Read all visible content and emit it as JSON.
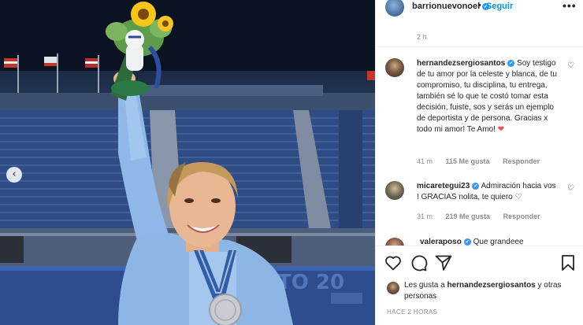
{
  "post": {
    "owner": "barrionuevonoel",
    "follow_label": "Seguir",
    "more_label": "•••",
    "time_ago": "2 h",
    "carousel_prev_icon": "chevron-left-icon",
    "carousel_prev_glyph": "‹"
  },
  "comments": [
    {
      "user": "hernandezsergiosantos",
      "text": "Soy testigo de tu amor por la celeste y blanca, de tu compromiso, tu disciplina, tu entrega, también sé lo que te costó tomar esta decisión, fuiste, sos y serás un ejemplo de deportista y de persona. Gracias x todo mi amor! Te Amo!",
      "emoji": "❤",
      "time": "41 m",
      "likes": "115 Me gusta",
      "reply": "Responder"
    },
    {
      "user": "micaretegui23",
      "text": "Admiración hacia vos ! GRACIAS nolita, te quiero",
      "emoji": "♡",
      "time": "31 m",
      "likes": "219 Me gusta",
      "reply": "Responder"
    },
    {
      "user": "valeraposo",
      "text": "Que grandeee"
    }
  ],
  "likes_summary": {
    "prefix": "Les gusta a ",
    "user": "hernandezsergiosantos",
    "suffix": " y otras personas"
  },
  "timestamp_label": "HACE 2 HORAS",
  "colors": {
    "accent": "#0095f6",
    "verified": "#3897f0",
    "heart": "#ed4956",
    "muted": "#8e8e8e"
  },
  "icons": [
    "heart-icon",
    "comment-icon",
    "share-icon",
    "bookmark-icon",
    "verified-icon"
  ]
}
